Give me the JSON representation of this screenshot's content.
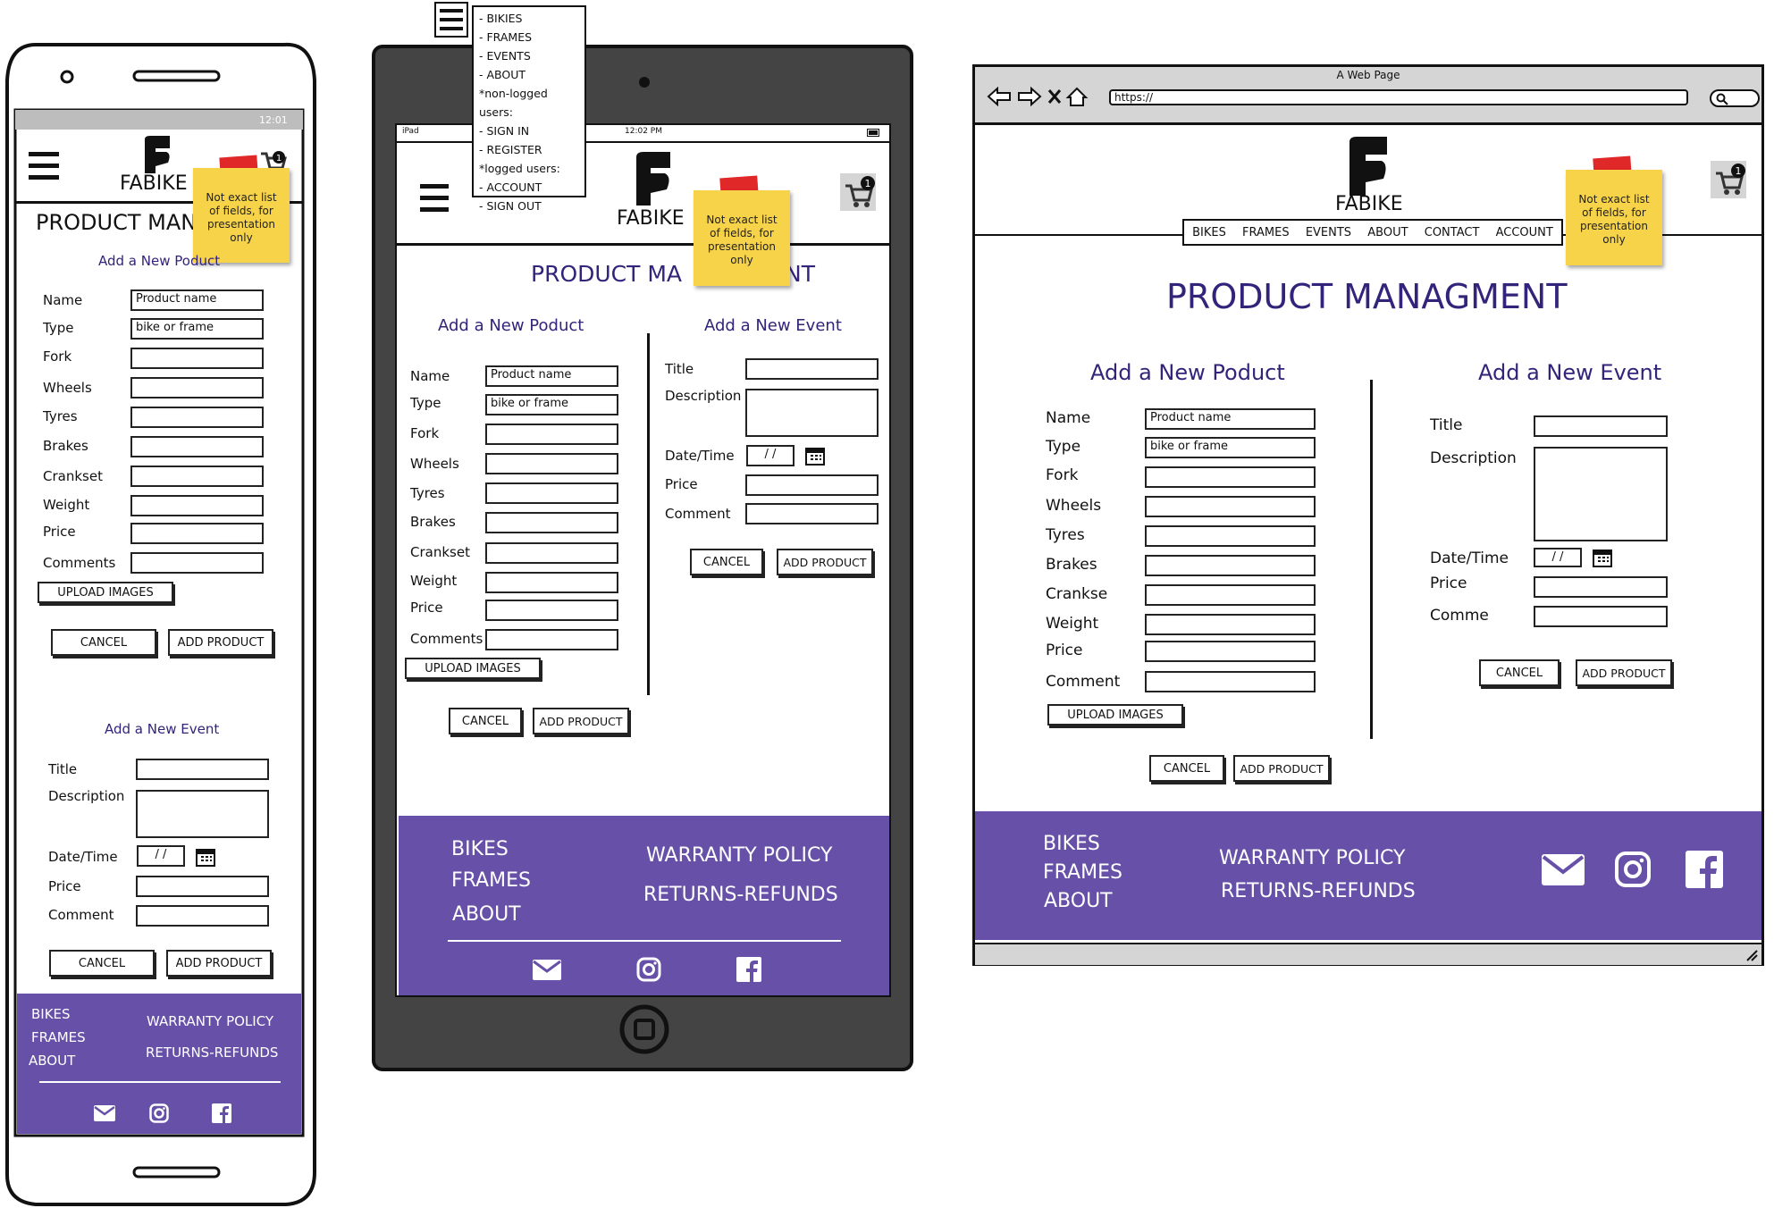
{
  "brand": "FABIKE",
  "note": [
    "Not exact list",
    "of fields, for",
    "presentation",
    "only"
  ],
  "cart_count": "1",
  "page_title": "PRODUCT MANAGMENT",
  "product": {
    "heading": "Add a New Poduct",
    "name_label": "Name",
    "name_placeholder": "Product name",
    "type_label": "Type",
    "type_placeholder": "bike or frame",
    "fork_label": "Fork",
    "wheels_label": "Wheels",
    "tyres_label": "Tyres",
    "brakes_label": "Brakes",
    "crankset_label": "Crankset",
    "crankset_label_desktop": "Crankse",
    "weight_label": "Weight",
    "price_label": "Price",
    "comments_label": "Comments",
    "comment_label_desktop": "Comment",
    "upload_label": "UPLOAD IMAGES",
    "cancel_label": "CANCEL",
    "add_label": "ADD PRODUCT"
  },
  "event": {
    "heading": "Add a New Event",
    "title_label": "Title",
    "description_label": "Description",
    "datetime_label": "Date/Time",
    "date_placeholder": "/ /",
    "price_label": "Price",
    "comment_label": "Comment",
    "comment_label_desktop": "Comme",
    "cancel_label": "CANCEL",
    "add_label": "ADD PRODUCT"
  },
  "footer": {
    "links": [
      "BIKES",
      "FRAMES",
      "ABOUT"
    ],
    "policy": [
      "WARRANTY POLICY",
      "RETURNS-REFUNDS"
    ]
  },
  "mobile": {
    "status": "12:01",
    "title_partial": "PRODUCT MAN"
  },
  "tablet": {
    "carrier": "iPad",
    "time": "12:02 PM",
    "title_left": "PRODUCT MA",
    "title_right": "NT",
    "menu": [
      "- BIKIES",
      "- FRAMES",
      "- EVENTS",
      "- ABOUT",
      "*non-logged users:",
      "- SIGN IN",
      "- REGISTER",
      "*logged users:",
      "- ACCOUNT",
      "- SIGN OUT"
    ]
  },
  "desktop": {
    "window_title": "A Web Page",
    "url": "https://",
    "nav": [
      "BIKES",
      "FRAMES",
      "EVENTS",
      "ABOUT",
      "CONTACT",
      "ACCOUNT"
    ]
  },
  "colors": {
    "footer": "#6650a8",
    "heading": "#33237a",
    "note": "#f7d34a",
    "tape": "#e02828"
  }
}
